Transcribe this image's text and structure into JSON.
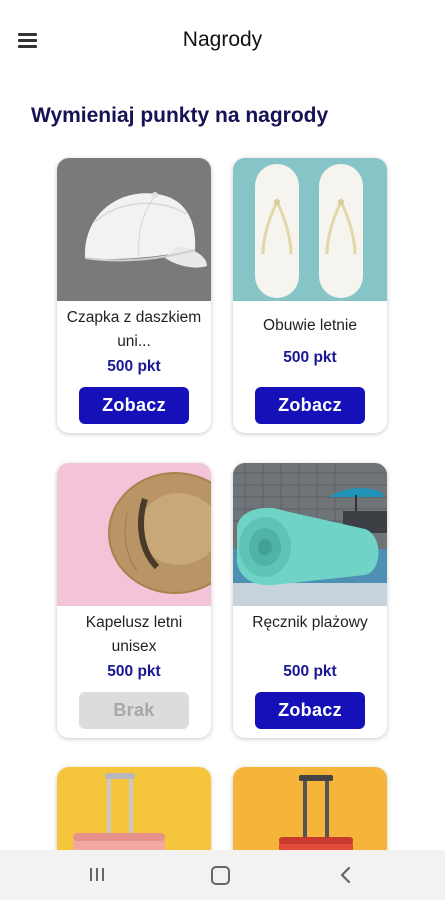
{
  "appbar": {
    "title": "Nagrody",
    "menu_icon": "hamburger-menu-icon"
  },
  "section": {
    "title": "Wymieniaj punkty na nagrody"
  },
  "rewards": [
    {
      "name": "Czapka z daszkiem uni...",
      "price": "500 pkt",
      "button": "Zobacz",
      "available": true,
      "image": "white-cap"
    },
    {
      "name": "Obuwie letnie",
      "price": "500 pkt",
      "button": "Zobacz",
      "available": true,
      "image": "white-flip-flops"
    },
    {
      "name": "Kapelusz letni unisex",
      "price": "500 pkt",
      "button": "Brak",
      "available": false,
      "image": "straw-hat"
    },
    {
      "name": "Ręcznik plażowy",
      "price": "500 pkt",
      "button": "Zobacz",
      "available": true,
      "image": "turquoise-towel"
    },
    {
      "image": "pink-suitcase"
    },
    {
      "image": "red-suitcase"
    }
  ],
  "colors": {
    "accent": "#1510b7",
    "title": "#161253",
    "price": "#1b1792",
    "disabled_bg": "#dcdcdc",
    "disabled_text": "#a8a8a8"
  },
  "navbar": {
    "recent_icon": "recent-apps-icon",
    "home_icon": "home-icon",
    "back_icon": "back-icon"
  }
}
